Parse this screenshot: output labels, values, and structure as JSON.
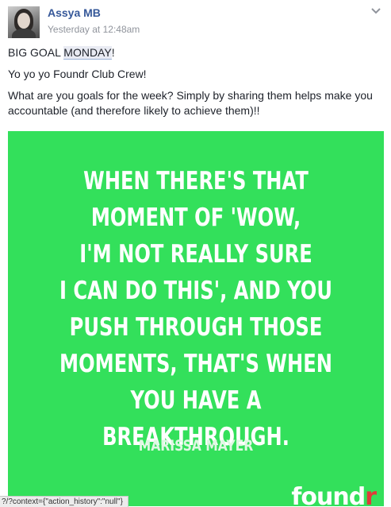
{
  "post": {
    "author": "Assya MB",
    "timestamp": "Yesterday at 12:48am",
    "line1_before": "BIG GOAL ",
    "line1_highlight": "MONDAY",
    "line1_after": "!",
    "line2": "Yo yo yo Foundr Club Crew!",
    "line3": "What are you goals for the week? Simply by sharing them helps make you accountable (and therefore likely to achieve them)!!"
  },
  "image": {
    "background_color": "#33e05b",
    "quote_lines": [
      "WHEN THERE'S THAT",
      "MOMENT OF 'WOW,",
      "I'M NOT REALLY SURE",
      "I CAN DO THIS', AND YOU",
      "PUSH THROUGH THOSE",
      "MOMENTS, THAT'S WHEN",
      "YOU HAVE A BREAKTHROUGH."
    ],
    "quote_author": "MARISSA MAYER",
    "logo_main": "found",
    "logo_accent": "r"
  },
  "status_bar": {
    "url": "?/?context={\"action_history\":\"null\"}"
  },
  "colors": {
    "link": "#365899",
    "brand_green": "#33e05b",
    "logo_accent": "#e03a3a"
  },
  "icons": {
    "menu": "chevron-down-icon",
    "avatar": "profile-photo"
  }
}
